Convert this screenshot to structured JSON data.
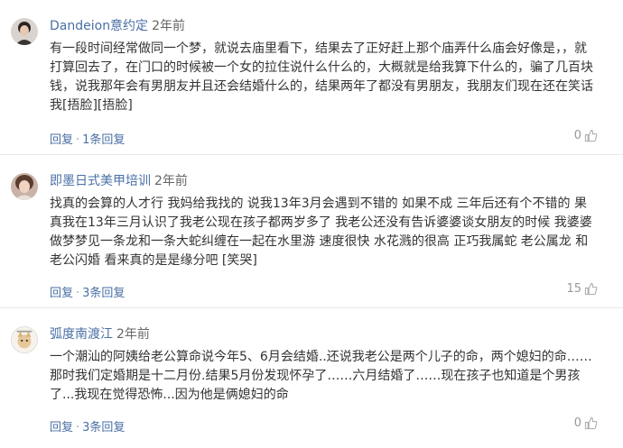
{
  "comments": [
    {
      "username": "Dandeion意约定",
      "time": "2年前",
      "avatar_icon": "avatar-icon",
      "text": "有一段时间经常做同一个梦，就说去庙里看下，结果去了正好赶上那个庙弄什么庙会好像是，，就打算回去了，在门口的时候被一个女的拉住说什么什么的，大概就是给我算下什么的，骗了几百块钱，说我那年会有男朋友并且还会结婚什么的，结果两年了都没有男朋友，我朋友们现在还在笑话我[捂脸][捂脸]",
      "reply_label": "回复",
      "separator": "·",
      "reply_count_label": "1条回复",
      "likes": "0"
    },
    {
      "username": "即墨日式美甲培训",
      "time": "2年前",
      "avatar_icon": "avatar-icon",
      "text": "找真的会算的人才行 我妈给我找的 说我13年3月会遇到不错的 如果不成 三年后还有个不错的 果真我在13年三月认识了我老公现在孩子都两岁多了 我老公还没有告诉婆婆谈女朋友的时候 我婆婆做梦梦见一条龙和一条大蛇纠缠在一起在水里游 速度很快 水花溅的很高 正巧我属蛇 老公属龙 和老公闪婚 看来真的是是缘分吧 [笑哭]",
      "reply_label": "回复",
      "separator": "·",
      "reply_count_label": "3条回复",
      "likes": "15"
    },
    {
      "username": "弧度南渡江",
      "time": "2年前",
      "avatar_icon": "avatar-icon",
      "text": "一个潮汕的阿姨给老公算命说今年5、6月会结婚..还说我老公是两个儿子的命，两个媳妇的命……那时我们定婚期是十二月份.结果5月份发现怀孕了……六月结婚了……现在孩子也知道是个男孩了...我现在觉得恐怖...因为他是俩媳妇的命",
      "reply_label": "回复",
      "separator": "·",
      "reply_count_label": "3条回复",
      "likes": "0"
    }
  ]
}
